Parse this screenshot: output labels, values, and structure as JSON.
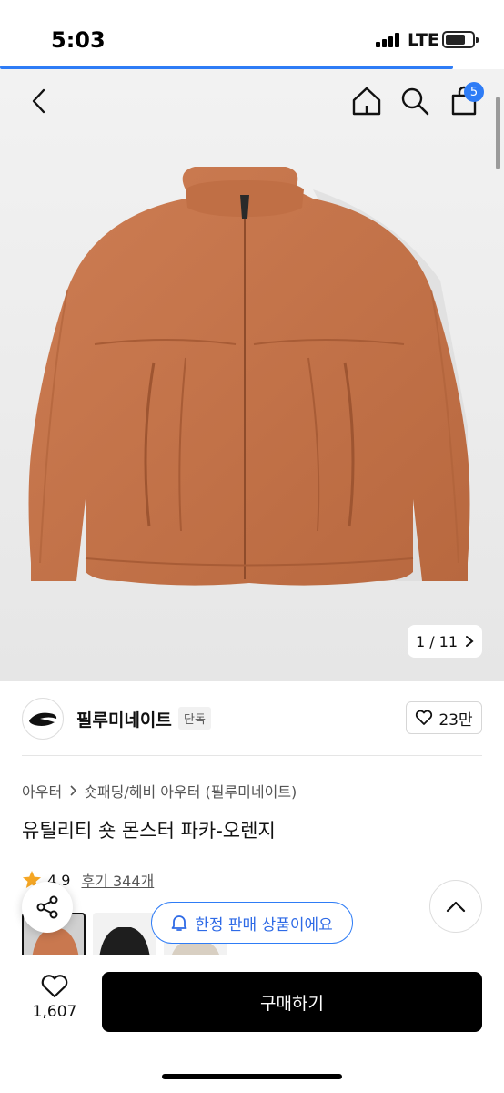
{
  "status": {
    "time": "5:03",
    "network": "LTE"
  },
  "nav": {
    "cart_count": "5"
  },
  "gallery": {
    "counter": "1 / 11"
  },
  "brand": {
    "name": "필루미네이트",
    "exclusive_badge": "단독",
    "likes": "23만"
  },
  "product": {
    "breadcrumb": [
      "아우터",
      "숏패딩/헤비 아우터 (필루미네이트)"
    ],
    "title": "유틸리티 숏 몬스터 파카-오렌지",
    "rating": "4.9",
    "reviews": "후기 344개"
  },
  "colors": {
    "accent": "#2e7cf6",
    "jacket": "#c9784f",
    "buy_button": "#000000",
    "star": "#f5a623"
  },
  "thumbnails": [
    {
      "color": "orange",
      "selected": true
    },
    {
      "color": "black",
      "selected": false
    },
    {
      "color": "beige",
      "selected": false
    }
  ],
  "limited": {
    "label": "한정 판매 상품이에요"
  },
  "bottom": {
    "wish_count": "1,607",
    "buy_label": "구매하기"
  },
  "icons": [
    "back-icon",
    "home-icon",
    "search-icon",
    "shopping-bag-icon",
    "chevron-right-icon",
    "heart-icon",
    "star-icon",
    "share-icon",
    "bell-icon",
    "chevron-up-icon"
  ]
}
